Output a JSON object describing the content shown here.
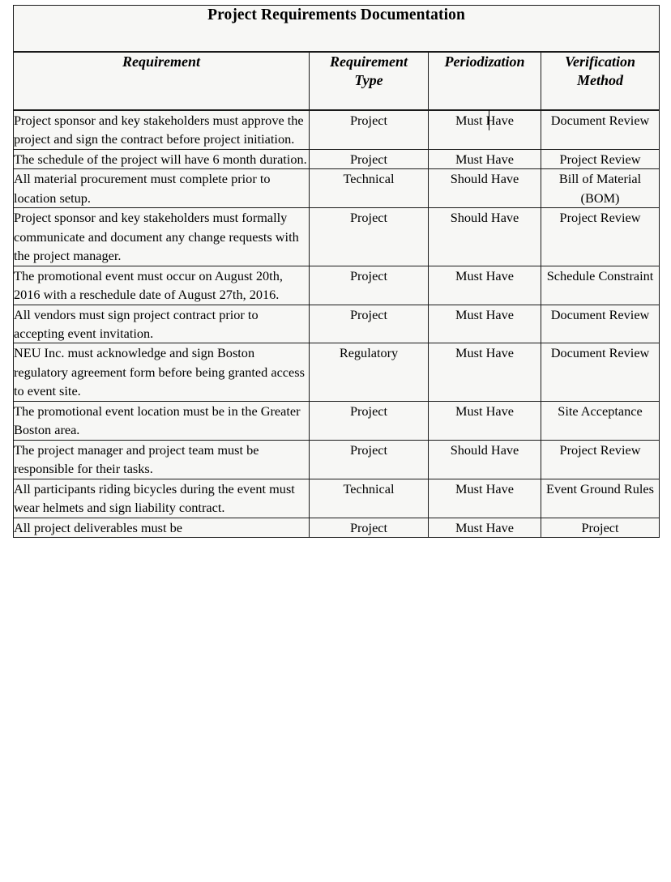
{
  "document": {
    "title": "Project Requirements Documentation",
    "caret_visible": true,
    "caret_location": "periodization cell of row 1, between \"H\" and \"ave\""
  },
  "table": {
    "headers": {
      "requirement": "Requirement",
      "requirement_type_line1": "Requirement",
      "requirement_type_line2": "Type",
      "periodization": "Periodization",
      "verification_method_line1": "Verification",
      "verification_method_line2": "Method"
    },
    "rows": [
      {
        "requirement": "Project sponsor and key stakeholders must approve the project and sign the contract before project initiation.",
        "type": "Project",
        "periodization": "Must Have",
        "verification": "Document Review"
      },
      {
        "requirement": "The schedule of the project will have 6 month duration.",
        "type": "Project",
        "periodization": "Must Have",
        "verification": "Project Review"
      },
      {
        "requirement": "All material procurement must complete prior to location setup.",
        "type": "Technical",
        "periodization": "Should Have",
        "verification": "Bill of Material (BOM)"
      },
      {
        "requirement": "Project sponsor and key stakeholders must formally communicate and document any change requests with the project manager.",
        "type": "Project",
        "periodization": "Should Have",
        "verification": "Project Review"
      },
      {
        "requirement": "The promotional event must occur on August 20th, 2016 with a reschedule date of August 27th, 2016.",
        "type": "Project",
        "periodization": "Must Have",
        "verification": "Schedule Constraint"
      },
      {
        "requirement": "All vendors must sign project contract prior to accepting event invitation.",
        "type": "Project",
        "periodization": "Must Have",
        "verification": "Document Review"
      },
      {
        "requirement": "NEU Inc. must acknowledge and sign Boston regulatory agreement form before being granted access to event site.",
        "type": "Regulatory",
        "periodization": "Must Have",
        "verification": "Document Review"
      },
      {
        "requirement": "The promotional event location must be in the Greater Boston area.",
        "type": "Project",
        "periodization": "Must Have",
        "verification": "Site Acceptance"
      },
      {
        "requirement": "The project manager and project team must be responsible for their tasks.",
        "type": "Project",
        "periodization": "Should Have",
        "verification": "Project Review"
      },
      {
        "requirement": "All participants riding bicycles during the event must wear helmets and sign liability contract.",
        "type": "Technical",
        "periodization": "Must Have",
        "verification": "Event Ground Rules"
      },
      {
        "requirement": "All project deliverables must be",
        "type": "Project",
        "periodization": "Must Have",
        "verification": "Project"
      }
    ]
  },
  "colors": {
    "page_background": "#ffffff",
    "cell_background": "#f7f7f5",
    "border": "#1a1a1a",
    "text": "#000000"
  }
}
